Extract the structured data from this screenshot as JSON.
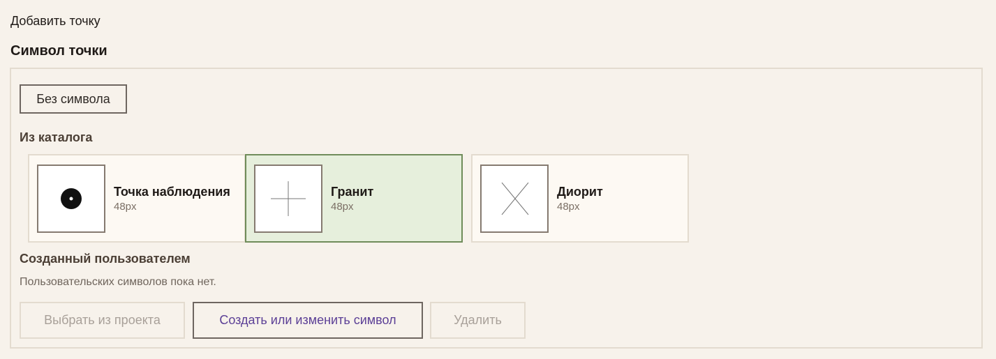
{
  "header": {
    "title": "Добавить точку"
  },
  "section": {
    "title": "Символ точки"
  },
  "no_symbol_label": "Без символа",
  "catalog": {
    "label": "Из каталога",
    "items": [
      {
        "name": "Точка наблюдения",
        "size": "48px",
        "icon": "observation-point-icon",
        "selected": false
      },
      {
        "name": "Гранит",
        "size": "48px",
        "icon": "plus-cross-icon",
        "selected": true
      },
      {
        "name": "Диорит",
        "size": "48px",
        "icon": "x-cross-icon",
        "selected": false
      }
    ]
  },
  "user_symbols": {
    "label": "Созданный пользователем",
    "empty_text": "Пользовательских символов пока нет."
  },
  "actions": {
    "pick_from_project": "Выбрать из проекта",
    "create_or_edit": "Создать или изменить символ",
    "delete": "Удалить"
  },
  "colors": {
    "background": "#f7f2eb",
    "selected_card": "#e6efdc",
    "selected_border": "#6f8c5a",
    "accent_text": "#5b3f96"
  }
}
